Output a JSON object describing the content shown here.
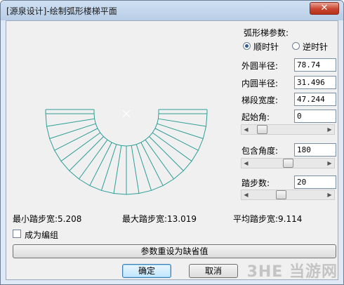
{
  "window": {
    "title": "[源泉设计]-绘制弧形楼梯平面",
    "close_label": "✕"
  },
  "params": {
    "group_title": "弧形梯参数:",
    "clockwise_label": "顺时针",
    "counterclockwise_label": "逆时针",
    "direction": "clockwise",
    "outer_radius_label": "外圆半径:",
    "outer_radius_value": "78.74",
    "inner_radius_label": "内圆半径:",
    "inner_radius_value": "31.496",
    "width_label": "梯段宽度:",
    "width_value": "47.244",
    "start_angle_label": "起始角:",
    "start_angle_value": "0",
    "start_angle_slider": 0.1,
    "sweep_angle_label": "包含角度:",
    "sweep_angle_value": "180",
    "sweep_angle_slider": 0.5,
    "steps_label": "踏步数:",
    "steps_value": "20",
    "steps_slider": 0.4
  },
  "preview": {
    "steps": 20,
    "sweep_degrees": 180,
    "inner_radius": 31.496,
    "outer_radius": 78.74,
    "line_color": "#2e9e97"
  },
  "stats": {
    "min_tread": "最小踏步宽:5.208",
    "max_tread": "最大踏步宽:13.019",
    "avg_tread": "平均踏步宽:9.114"
  },
  "group_checkbox_label": "成为编组",
  "reset_button": "参数重设为缺省值",
  "ok_button": "确定",
  "cancel_button": "取消",
  "watermark": "3HE 当游网"
}
